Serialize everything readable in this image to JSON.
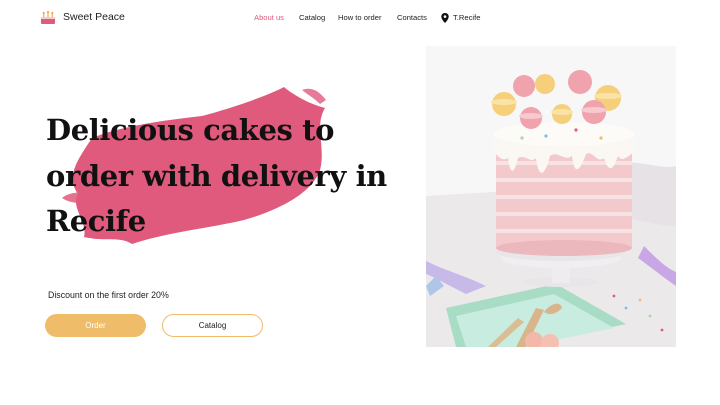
{
  "brand": {
    "name": "Sweet Peace",
    "icon": "cake-icon"
  },
  "nav": {
    "items": [
      {
        "label": "About us",
        "active": true
      },
      {
        "label": "Catalog",
        "active": false
      },
      {
        "label": "How to order",
        "active": false
      },
      {
        "label": "Contacts",
        "active": false
      }
    ],
    "location": {
      "label": "T.Recife",
      "icon": "location-pin-icon"
    }
  },
  "hero": {
    "title": "Delicious cakes to order with delivery in Recife",
    "discount_text": "Discount on the first order 20%",
    "order_button": "Order",
    "catalog_button": "Catalog"
  },
  "colors": {
    "accent_pink": "#e05a7d",
    "button_yellow": "#efbd6a",
    "text_dark": "#111111"
  }
}
